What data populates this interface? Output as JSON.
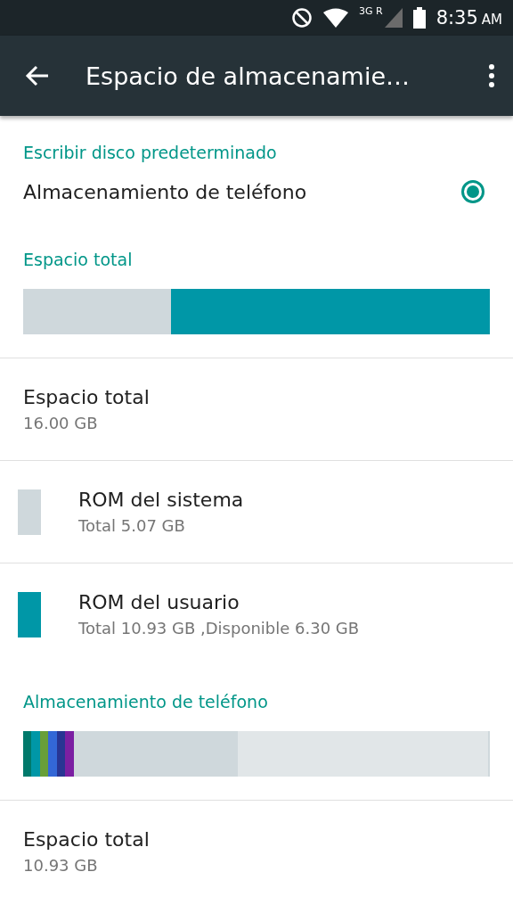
{
  "status_bar": {
    "time": "8:35",
    "ampm": "AM",
    "network": "3G R"
  },
  "toolbar": {
    "title": "Espacio de almacenamie…"
  },
  "sections": [
    {
      "kind": "radio",
      "header": "Escribir disco predeterminado",
      "label": "Almacenamiento de teléfono",
      "selected": true
    },
    {
      "kind": "usage",
      "header": "Espacio total",
      "segments": [
        {
          "color": "#cfd8dc"
        },
        {
          "color": "#0097a7"
        }
      ],
      "rows": [
        {
          "kind": "plain",
          "title": "Espacio total",
          "subtitle": "16.00 GB"
        },
        {
          "kind": "legend",
          "color": "#cfd8dc",
          "title": "ROM del sistema",
          "subtitle": "Total 5.07 GB"
        },
        {
          "kind": "legend",
          "color": "#0097a7",
          "title": "ROM del usuario",
          "subtitle": "Total 10.93 GB ,Disponible 6.30 GB"
        }
      ]
    },
    {
      "kind": "usage",
      "header": "Almacenamiento de teléfono",
      "segments": [
        {
          "color": "#00796b"
        },
        {
          "color": "#0097a7"
        },
        {
          "color": "#689f38"
        },
        {
          "color": "#3367d6"
        },
        {
          "color": "#283593"
        },
        {
          "color": "#7b1fa2"
        },
        {
          "color": "#cfd8dc"
        },
        {
          "color": "#e1e6e8"
        },
        {
          "color": "#cfd8dc"
        }
      ],
      "rows": [
        {
          "kind": "plain",
          "title": "Espacio total",
          "subtitle": "10.93 GB"
        }
      ]
    }
  ]
}
